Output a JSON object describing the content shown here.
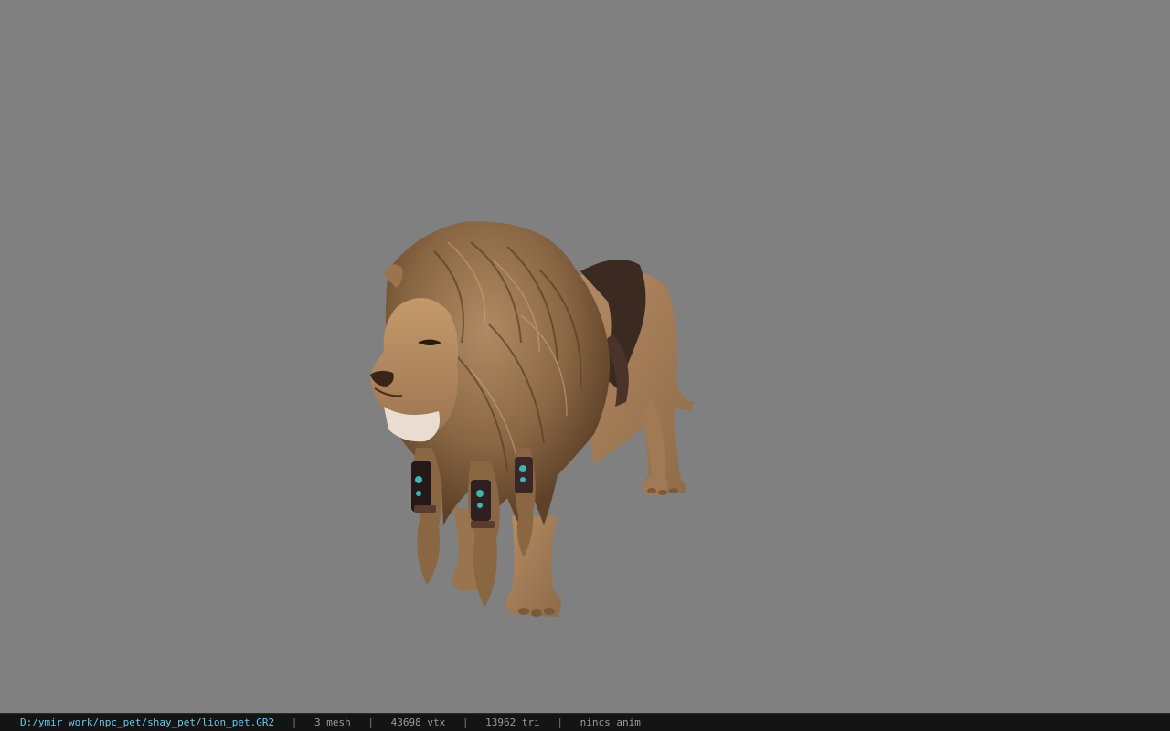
{
  "viewport": {
    "background": "#808080",
    "model_name": "lion_pet"
  },
  "statusbar": {
    "file_path": "D:/ymir work/npc_pet/shay_pet/lion_pet.GR2",
    "mesh_count": "3 mesh",
    "vertex_count": "43698 vtx",
    "triangle_count": "13962 tri",
    "animation": "nincs anim",
    "separator": "|",
    "path_color": "#6ec6e6"
  }
}
